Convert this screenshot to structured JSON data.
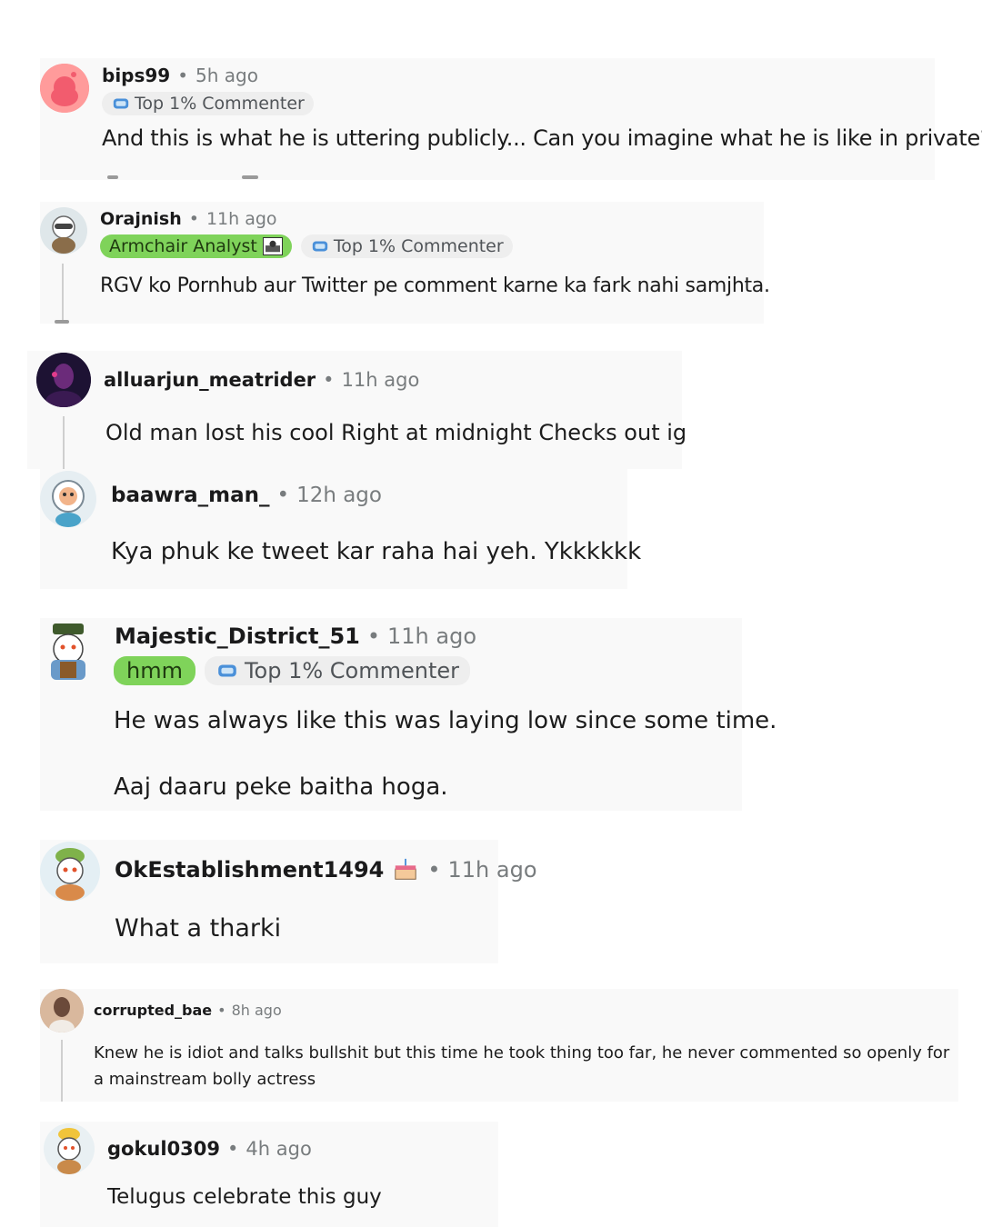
{
  "comments": [
    {
      "username": "bips99",
      "time": "5h ago",
      "flairs": [
        {
          "label": "Top 1% Commenter",
          "icon": "trophy-icon"
        }
      ],
      "body": "And this is what he is uttering publicly... Can you imagine what he is like in private?"
    },
    {
      "username": "Orajnish",
      "time": "11h ago",
      "flairs": [
        {
          "label": "Armchair Analyst",
          "icon": "flair-emoji-icon"
        },
        {
          "label": "Top 1% Commenter",
          "icon": "trophy-icon"
        }
      ],
      "body": "RGV ko Pornhub aur Twitter pe comment karne ka fark nahi samjhta."
    },
    {
      "username": "alluarjun_meatrider",
      "time": "11h ago",
      "body": "Old man lost his cool Right at midnight Checks out ig"
    },
    {
      "username": "baawra_man_",
      "time": "12h ago",
      "body": "Kya phuk ke tweet kar raha hai yeh. Ykkkkkk"
    },
    {
      "username": "Majestic_District_51",
      "time": "11h ago",
      "flairs": [
        {
          "label": "hmm"
        },
        {
          "label": "Top 1% Commenter",
          "icon": "trophy-icon"
        }
      ],
      "body": "He was always like this was laying low since some time.",
      "body2": "Aaj daaru peke baitha hoga."
    },
    {
      "username": "OkEstablishment1494",
      "time": "11h ago",
      "username_icon": "cake-icon",
      "body": "What a tharki"
    },
    {
      "username": "corrupted_bae",
      "time": "8h ago",
      "body": "Knew he is idiot and talks bullshit but this time he took thing too far, he never commented so openly for a mainstream bolly actress"
    },
    {
      "username": "gokul0309",
      "time": "4h ago",
      "body": "Telugus celebrate this guy"
    }
  ],
  "separator": "•",
  "colors": {
    "background": "#ffffff",
    "card": "#f9f9f9",
    "username": "#1a1a1b",
    "meta": "#787c7e",
    "flair_green": "#7fd35a",
    "flair_grey": "#eeeeee"
  }
}
